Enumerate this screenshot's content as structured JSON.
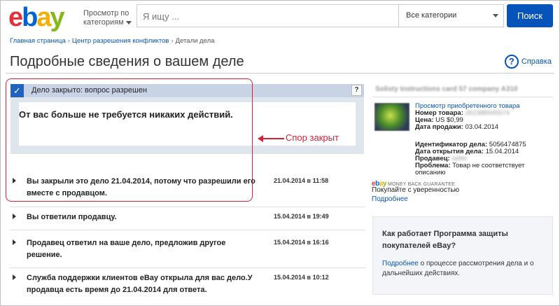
{
  "header": {
    "logo": {
      "e": "e",
      "b": "b",
      "a": "a",
      "y": "y"
    },
    "browse_line1": "Просмотр по",
    "browse_line2": "категориям",
    "search_placeholder": "Я ищу ...",
    "category": "Все категории",
    "search_button": "Поиск"
  },
  "breadcrumb": {
    "home": "Главная страница",
    "resolution_center": "Центр разрешения конфликтов",
    "current": "Детали дела"
  },
  "page": {
    "title": "Подробные сведения о вашем деле",
    "help": "Справка"
  },
  "status": {
    "label": "Дело закрыто: вопрос разрешен",
    "help_mark": "?",
    "message": "От вас больше не требуется никаких действий."
  },
  "annotation": {
    "text": "Спор закрыт",
    "color": "#d4213a"
  },
  "history": [
    {
      "message": "Вы закрыли это дело 21.04.2014, потому что разрешили его вместе с продавцом.",
      "date": "21.04.2014 в 11:58"
    },
    {
      "message": "Вы ответили продавцу.",
      "date": "15.04.2014 в 19:49"
    },
    {
      "message": "Продавец ответил на ваше дело, предложив другое решение.",
      "date": "15.04.2014 в 16:16"
    },
    {
      "message": "Служба поддержки клиентов eBay открыла для вас дело.У продавца есть время до 21.04.2014 для ответа.",
      "date": "15.04.2014 в 10:12"
    }
  ],
  "sidebar": {
    "item_title": "Solisty Instructions card 57 company A310",
    "view_item": "Просмотр приобретенного товара",
    "item_number_label": "Номер товара:",
    "item_number_value": "262388945574",
    "price_label": "Цена:",
    "price_value": "US $0,99",
    "sale_date_label": "Дата продажи:",
    "sale_date_value": "03.04.2014",
    "case_id_label": "Идентификатор дела:",
    "case_id_value": "5056474875",
    "open_date_label": "Дата открытия дела:",
    "open_date_value": "15.04.2014",
    "seller_label": "Продавец:",
    "seller_value": "seller",
    "problem_label": "Проблема:",
    "problem_value_line1": "Товар не соответствует",
    "problem_value_line2": "описанию",
    "guarantee_small": "MONEY BACK GUARANTEE",
    "confidence": "Покупайте с уверенностью",
    "more": "Подробнее",
    "promo_title": "Как работает Программа защиты покупателей eBay?",
    "promo_link": "Подробнее",
    "promo_text": " о процессе рассмотрения дела и о дальнейших действиях."
  },
  "colors": {
    "brand_blue": "#0654ba",
    "status_bar": "#c8d4e6",
    "status_panel": "#dfe5ed",
    "check_blue": "#1f62c2"
  }
}
